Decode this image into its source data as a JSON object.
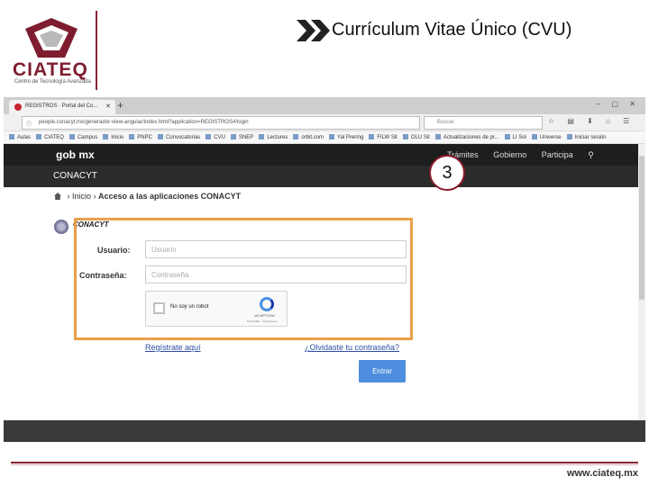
{
  "slide": {
    "title": "Currículum Vitae Único (CVU)",
    "logo_text": "CIATEQ",
    "logo_subtitle": "Centro de Tecnología Avanzada",
    "footer_url": "www.ciateq.mx",
    "step_number": "3",
    "colors": {
      "brand": "#8a2236",
      "highlight": "#e8a04a",
      "button": "#4e8ede"
    }
  },
  "browser": {
    "tab_title": "REGISTROS · Portal del Co...",
    "url": "people.conacyt.mx/generador-view-angular/index.html?application=REGISTROS#/login",
    "search_placeholder": "Buscar",
    "bookmarks": [
      "Aulas",
      "CIATEQ",
      "Campus",
      "Inicio",
      "PNPC",
      "Convocatorias",
      "CVU",
      "SNEP",
      "Lectures",
      "orbit.com",
      "Yal Prering",
      "FILW Sit",
      "OLU Sit",
      "Actualizaciones de pr...",
      "LI Sol",
      "Universe",
      "Iniciar sesión"
    ]
  },
  "page": {
    "gob_brand": "gob mx",
    "nav": [
      "Trámites",
      "Gobierno",
      "Participa"
    ],
    "section_bar": "CONACYT",
    "breadcrumb_home": "Inicio",
    "breadcrumb_current": "Acceso a las aplicaciones CONACYT",
    "org_name": "CONACYT",
    "form": {
      "username_label": "Usuario:",
      "username_placeholder": "Usuario",
      "password_label": "Contraseña:",
      "password_placeholder": "Contraseña",
      "captcha_text": "No soy un robot",
      "captcha_brand": "reCAPTCHA",
      "captcha_terms": "Privacidad · Condiciones",
      "register_link": "Regístrate aquí",
      "forgot_link": "¿Olvidaste tu contraseña?",
      "submit_label": "Entrar"
    }
  }
}
